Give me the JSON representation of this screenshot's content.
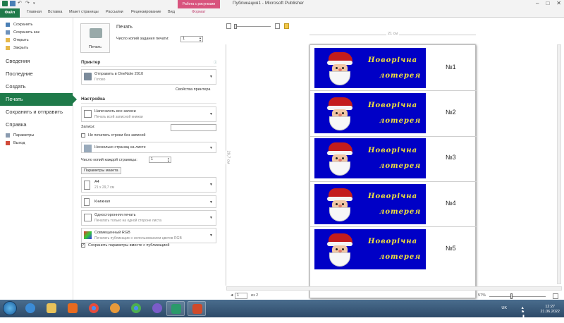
{
  "window": {
    "title": "Публикация1 - Microsoft Publisher",
    "context_tab": "Работа с рисунками",
    "controls": [
      "–",
      "□",
      "✕"
    ]
  },
  "ribbon": {
    "tabs": [
      "Файл",
      "Главная",
      "Вставка",
      "Макет страницы",
      "Рассылки",
      "Рецензирование",
      "Вид",
      "Формат"
    ]
  },
  "backstage": {
    "small_items": [
      {
        "label": "Сохранить",
        "icon": "save-icon"
      },
      {
        "label": "Сохранить как",
        "icon": "save-as-icon"
      },
      {
        "label": "Открыть",
        "icon": "open-folder-icon"
      },
      {
        "label": "Закрыть",
        "icon": "close-file-icon"
      }
    ],
    "big_items": [
      "Сведения",
      "Последние",
      "Создать",
      "Печать",
      "Сохранить и отправить",
      "Справка"
    ],
    "active": "Печать",
    "bottom_items": [
      {
        "label": "Параметры",
        "icon": "options-icon"
      },
      {
        "label": "Выход",
        "icon": "exit-icon"
      }
    ]
  },
  "print": {
    "button_label": "Печать",
    "title": "Печать",
    "copies_label": "Число копий задания печати:",
    "copies_value": "1",
    "printer_heading": "Принтер",
    "printer_name": "Отправить в OneNote 2010",
    "printer_status": "Готово",
    "printer_props": "Свойства принтера",
    "settings_heading": "Настройка",
    "range_title": "Напечатать все записи",
    "range_sub": "Печать всей записной книжки",
    "records_label": "Записи:",
    "no_blank_label": "Не печатать строки без записей",
    "layout_title": "Несколько страниц на листе",
    "copies_per_sheet_label": "Число копий каждой страницы:",
    "copies_per_sheet_value": "1",
    "page_setup_button": "Параметры макета",
    "paper_title": "A4",
    "paper_sub": "21 x 29,7 см",
    "orientation_title": "Книжная",
    "sides_title": "Односторонняя печать",
    "sides_sub": "Печатать только на одной стороне листа",
    "color_title": "Совмещенный RGB",
    "color_sub": "Печатать публикацию с использованием цветов RGB",
    "save_settings_label": "Сохранить параметры вместе с публикацией",
    "save_settings_checked": true
  },
  "preview": {
    "ruler_width": "21 см",
    "ruler_height": "29,7 см",
    "tickets": [
      {
        "title": "Новорічна",
        "subtitle": "лотерея",
        "number": "№1"
      },
      {
        "title": "Новорічна",
        "subtitle": "лотерея",
        "number": "№2"
      },
      {
        "title": "Новорічна",
        "subtitle": "лотерея",
        "number": "№3"
      },
      {
        "title": "Новорічна",
        "subtitle": "лотерея",
        "number": "№4"
      },
      {
        "title": "Новорічна",
        "subtitle": "лотерея",
        "number": "№5"
      }
    ],
    "page_current": "1",
    "page_of": "из 2",
    "zoom": "57%"
  },
  "taskbar": {
    "apps": [
      {
        "name": "internet-explorer-icon",
        "color": "#3b8bd6"
      },
      {
        "name": "file-explorer-icon",
        "color": "#e8c25a"
      },
      {
        "name": "media-player-icon",
        "color": "#e86a1f"
      },
      {
        "name": "chrome-icon",
        "color": "#e74b3c"
      },
      {
        "name": "app-icon-orange",
        "color": "#e89a3a"
      },
      {
        "name": "chrome-icon-2",
        "color": "#4caf50"
      },
      {
        "name": "viber-icon",
        "color": "#7b5cc9"
      },
      {
        "name": "publisher-icon",
        "color": "#2b9a6a"
      },
      {
        "name": "powerpoint-icon",
        "color": "#d04a2a"
      }
    ],
    "lang": "UK",
    "time": "12:27",
    "date": "21.06.2022"
  },
  "colors": {
    "accent": "#1f7a4a",
    "ticket_bg": "#0000c6",
    "ticket_text": "#f3e23b",
    "context_tab": "#d8537d"
  }
}
